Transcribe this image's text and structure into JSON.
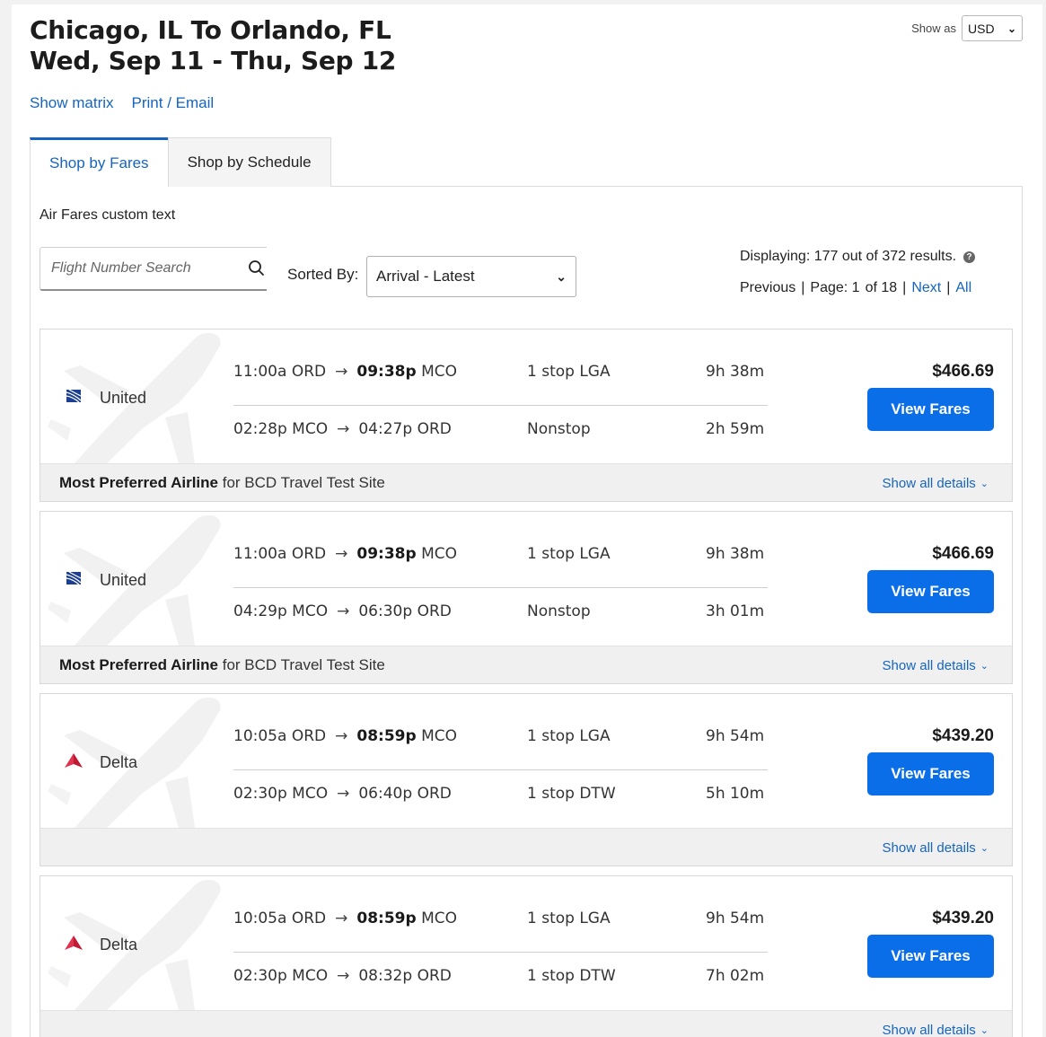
{
  "header": {
    "title_line1": "Chicago, IL To Orlando, FL",
    "title_line2": "Wed, Sep 11 - Thu, Sep 12",
    "show_as_label": "Show as",
    "currency": "USD"
  },
  "links": {
    "show_matrix": "Show matrix",
    "print_email": "Print / Email"
  },
  "tabs": [
    {
      "label": "Shop by Fares"
    },
    {
      "label": "Shop by Schedule"
    }
  ],
  "custom_text": "Air Fares custom text",
  "search": {
    "placeholder": "Flight Number Search"
  },
  "sort": {
    "label": "Sorted By:",
    "value": "Arrival - Latest"
  },
  "results": {
    "displaying": "Displaying: 177 out of 372 results.",
    "previous": "Previous",
    "page_label": "Page: 1",
    "of_label": "of 18",
    "next": "Next",
    "all": "All"
  },
  "colors": {
    "accent": "#0a6ee8",
    "link": "#1565c0",
    "united": "#1c3f94",
    "delta": "#c01933"
  },
  "cards": [
    {
      "airline": "United",
      "logo": "united-logo",
      "legs": [
        {
          "dep": "11:00a ORD",
          "arr_time": "09:38p",
          "arr_code": "MCO",
          "arr_bold": true,
          "stops": "1 stop LGA",
          "duration": "9h 38m"
        },
        {
          "dep": "02:28p MCO",
          "arr_time": "04:27p",
          "arr_code": "ORD",
          "arr_bold": false,
          "stops": "Nonstop",
          "duration": "2h 59m"
        }
      ],
      "price": "$466.69",
      "button": "View Fares",
      "preferred_bold": "Most Preferred Airline",
      "preferred_rest": "for BCD Travel Test Site",
      "details": "Show all details"
    },
    {
      "airline": "United",
      "logo": "united-logo",
      "legs": [
        {
          "dep": "11:00a ORD",
          "arr_time": "09:38p",
          "arr_code": "MCO",
          "arr_bold": true,
          "stops": "1 stop LGA",
          "duration": "9h 38m"
        },
        {
          "dep": "04:29p MCO",
          "arr_time": "06:30p",
          "arr_code": "ORD",
          "arr_bold": false,
          "stops": "Nonstop",
          "duration": "3h 01m"
        }
      ],
      "price": "$466.69",
      "button": "View Fares",
      "preferred_bold": "Most Preferred Airline",
      "preferred_rest": "for BCD Travel Test Site",
      "details": "Show all details"
    },
    {
      "airline": "Delta",
      "logo": "delta-logo",
      "legs": [
        {
          "dep": "10:05a ORD",
          "arr_time": "08:59p",
          "arr_code": "MCO",
          "arr_bold": true,
          "stops": "1 stop LGA",
          "duration": "9h 54m"
        },
        {
          "dep": "02:30p MCO",
          "arr_time": "06:40p",
          "arr_code": "ORD",
          "arr_bold": false,
          "stops": "1 stop DTW",
          "duration": "5h 10m"
        }
      ],
      "price": "$439.20",
      "button": "View Fares",
      "preferred_bold": "",
      "preferred_rest": "",
      "details": "Show all details"
    },
    {
      "airline": "Delta",
      "logo": "delta-logo",
      "legs": [
        {
          "dep": "10:05a ORD",
          "arr_time": "08:59p",
          "arr_code": "MCO",
          "arr_bold": true,
          "stops": "1 stop LGA",
          "duration": "9h 54m"
        },
        {
          "dep": "02:30p MCO",
          "arr_time": "08:32p",
          "arr_code": "ORD",
          "arr_bold": false,
          "stops": "1 stop DTW",
          "duration": "7h 02m"
        }
      ],
      "price": "$439.20",
      "button": "View Fares",
      "preferred_bold": "",
      "preferred_rest": "",
      "details": "Show all details"
    }
  ]
}
